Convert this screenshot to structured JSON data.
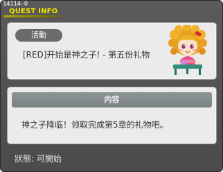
{
  "window": {
    "quest_id": "14114-0",
    "title": "QUEST INFO"
  },
  "quest": {
    "category_tag": "活動",
    "name": "[RED]开始是神之子! - 第五份礼物",
    "npc_icon": "npc-portrait-girl"
  },
  "content": {
    "header": "内容",
    "text": "神之子降临！领取完成第5章的礼物吧。"
  },
  "status": {
    "text": "狀態:  可開始"
  },
  "colors": {
    "title": "#f2e600",
    "panel": "#ebebeb",
    "frame": "#4f4f4f",
    "tag": "#6b6b6b"
  }
}
